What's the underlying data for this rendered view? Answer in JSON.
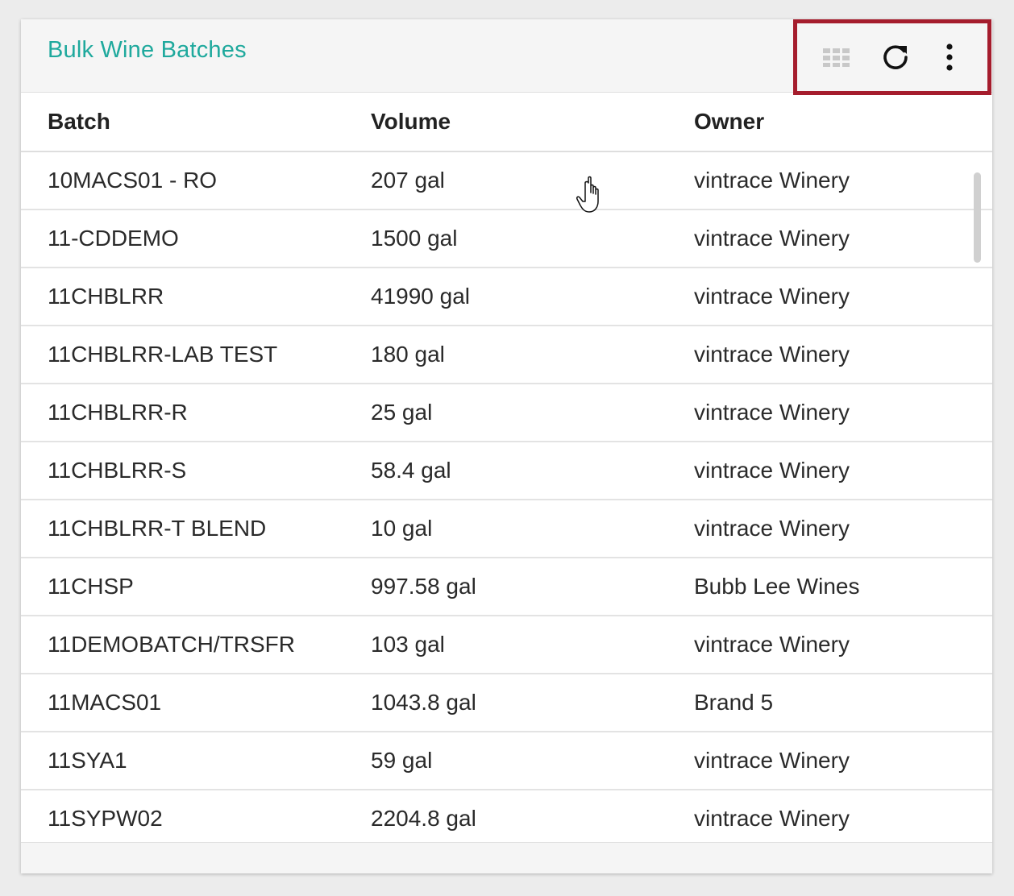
{
  "widget": {
    "title": "Bulk Wine Batches",
    "toolbar": {
      "grid_icon": "grid-icon",
      "refresh_icon": "refresh-icon",
      "more_icon": "more-vertical-icon"
    }
  },
  "table": {
    "columns": [
      "Batch",
      "Volume",
      "Owner"
    ],
    "rows": [
      {
        "batch": "10MACS01 - RO",
        "volume": "207 gal",
        "owner": "vintrace Winery"
      },
      {
        "batch": "11-CDDEMO",
        "volume": "1500 gal",
        "owner": "vintrace Winery"
      },
      {
        "batch": "11CHBLRR",
        "volume": "41990 gal",
        "owner": "vintrace Winery"
      },
      {
        "batch": "11CHBLRR-LAB TEST",
        "volume": "180 gal",
        "owner": "vintrace Winery"
      },
      {
        "batch": "11CHBLRR-R",
        "volume": "25 gal",
        "owner": "vintrace Winery"
      },
      {
        "batch": "11CHBLRR-S",
        "volume": "58.4 gal",
        "owner": "vintrace Winery"
      },
      {
        "batch": "11CHBLRR-T BLEND",
        "volume": "10 gal",
        "owner": "vintrace Winery"
      },
      {
        "batch": "11CHSP",
        "volume": "997.58 gal",
        "owner": "Bubb Lee Wines"
      },
      {
        "batch": "11DEMOBATCH/TRSFR",
        "volume": "103 gal",
        "owner": "vintrace Winery"
      },
      {
        "batch": "11MACS01",
        "volume": "1043.8 gal",
        "owner": "Brand 5"
      },
      {
        "batch": "11SYA1",
        "volume": "59 gal",
        "owner": "vintrace Winery"
      },
      {
        "batch": "11SYPW02",
        "volume": "2204.8 gal",
        "owner": "vintrace Winery"
      }
    ]
  },
  "colors": {
    "title": "#1fa99d",
    "highlight_border": "#a51d2d",
    "header_bg": "#f5f5f5"
  }
}
